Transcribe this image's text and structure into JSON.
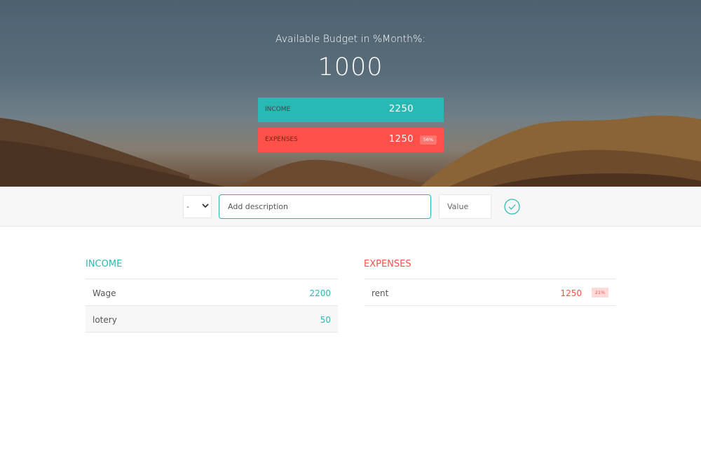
{
  "budget": {
    "title": "Available Budget in %Month%:",
    "value": "1000",
    "income_label": "Income",
    "income_value": "2250",
    "expenses_label": "Expenses",
    "expenses_value": "1250",
    "expenses_percentage": "56%"
  },
  "add_form": {
    "type_selected": "-",
    "description_placeholder": "Add description",
    "value_placeholder": "Value",
    "submit_icon": "check-circle-icon"
  },
  "income": {
    "title": "Income",
    "items": [
      {
        "description": "Wage",
        "value": "2200"
      },
      {
        "description": "lotery",
        "value": "50"
      }
    ]
  },
  "expenses": {
    "title": "Expenses",
    "items": [
      {
        "description": "rent",
        "value": "1250",
        "percentage": "21%"
      }
    ]
  },
  "colors": {
    "income": "#28b9b5",
    "expenses": "#ff5049"
  }
}
